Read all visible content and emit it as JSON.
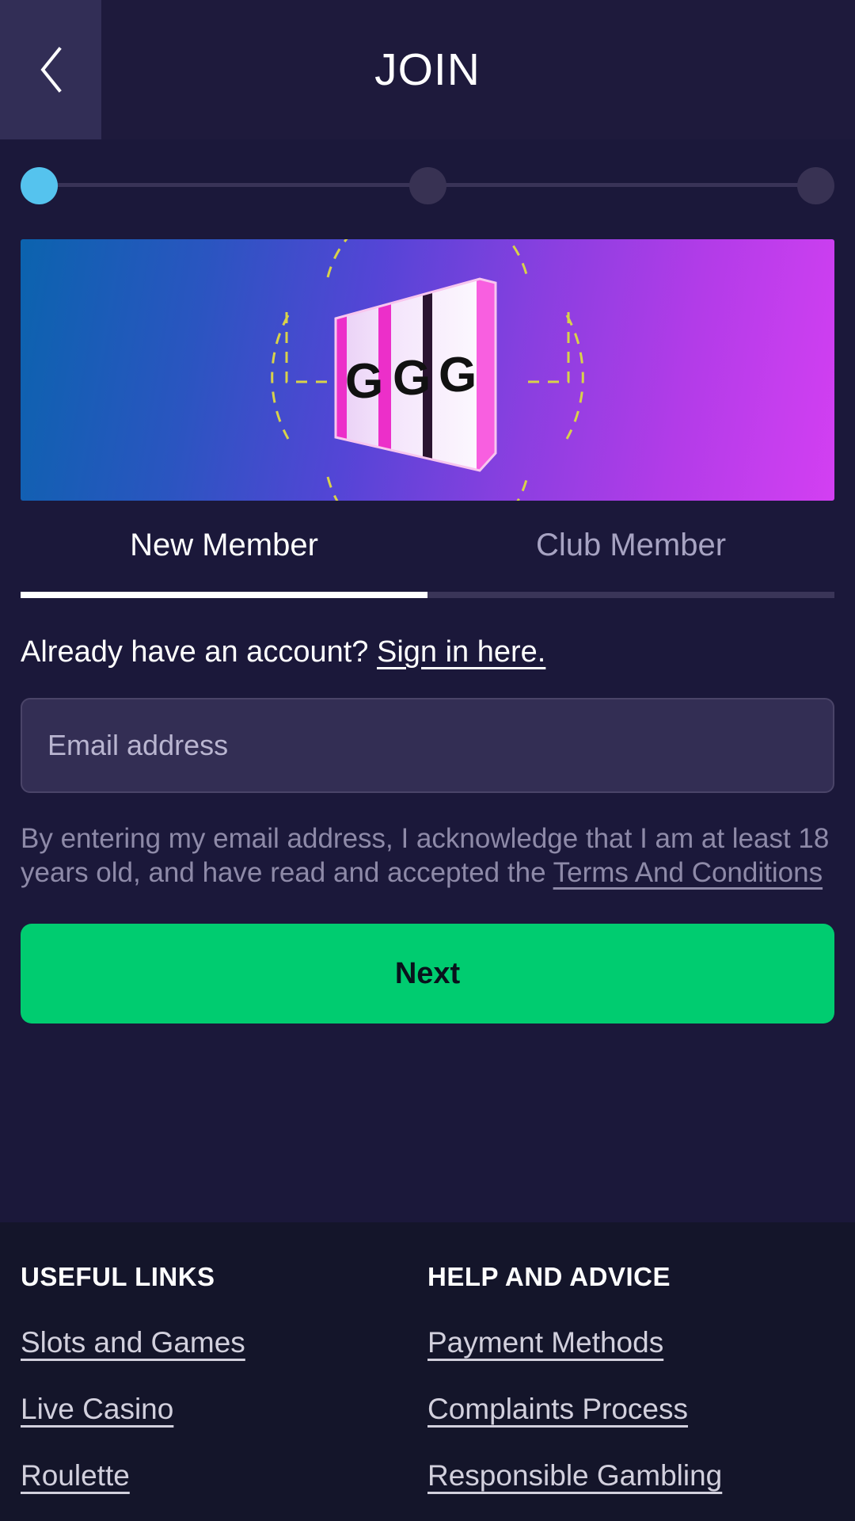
{
  "header": {
    "title": "JOIN",
    "back_icon": "chevron-left-icon"
  },
  "stepper": {
    "steps": [
      {
        "index": "1",
        "state": "active"
      },
      {
        "index": "2",
        "state": "inactive"
      },
      {
        "index": "3",
        "state": "inactive"
      }
    ],
    "active_color": "#55c3ee",
    "inactive_color": "#383253",
    "track_color": "#393357"
  },
  "banner": {
    "alt": "slot-machine-reels-graphic",
    "reel_symbols": [
      "G",
      "G",
      "G"
    ],
    "gradient_from": "#0b63ae",
    "gradient_to": "#d33ff2",
    "ring_color": "#d8d24a"
  },
  "tabs": [
    {
      "label": "New Member",
      "active": true
    },
    {
      "label": "Club Member",
      "active": false
    }
  ],
  "signin": {
    "prompt": "Already have an account?",
    "link": "Sign in here."
  },
  "email": {
    "placeholder": "Email address",
    "value": ""
  },
  "terms": {
    "text": "By entering my email address, I acknowledge that I am at least 18 years old, and have read and accepted the",
    "link": "Terms And Conditions"
  },
  "primary_action": {
    "label": "Next",
    "color": "#00cc70"
  },
  "footer": {
    "columns": [
      {
        "heading": "USEFUL LINKS",
        "links": [
          "Slots and Games",
          "Live Casino",
          "Roulette"
        ]
      },
      {
        "heading": "HELP AND ADVICE",
        "links": [
          "Payment Methods",
          "Complaints Process",
          "Responsible Gambling"
        ]
      }
    ]
  }
}
